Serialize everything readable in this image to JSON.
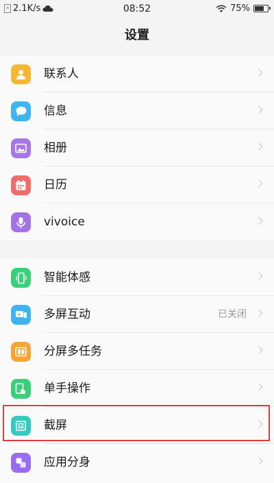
{
  "status_bar": {
    "network_speed": "2.1K/s",
    "time": "08:52",
    "battery": "75%",
    "battery_level": 0.75
  },
  "header": {
    "title": "设置"
  },
  "group1": [
    {
      "label": "联系人",
      "icon": "contacts-icon",
      "color": "#f7b731"
    },
    {
      "label": "信息",
      "icon": "messages-icon",
      "color": "#3eb5f1"
    },
    {
      "label": "相册",
      "icon": "gallery-icon",
      "color": "#a776e8"
    },
    {
      "label": "日历",
      "icon": "calendar-icon",
      "color": "#f36c6c"
    },
    {
      "label": "vivoice",
      "icon": "microphone-icon",
      "color": "#a572e6"
    }
  ],
  "group2": [
    {
      "label": "智能体感",
      "icon": "smart-motion-icon",
      "color": "#3ccf7a"
    },
    {
      "label": "多屏互动",
      "icon": "multi-screen-icon",
      "color": "#3eb5f1",
      "value": "已关闭"
    },
    {
      "label": "分屏多任务",
      "icon": "split-screen-icon",
      "color": "#f7a435"
    },
    {
      "label": "单手操作",
      "icon": "one-hand-icon",
      "color": "#3ccf7a"
    },
    {
      "label": "截屏",
      "icon": "screenshot-icon",
      "color": "#32cbbd"
    },
    {
      "label": "应用分身",
      "icon": "app-clone-icon",
      "color": "#9b6cf0"
    }
  ]
}
